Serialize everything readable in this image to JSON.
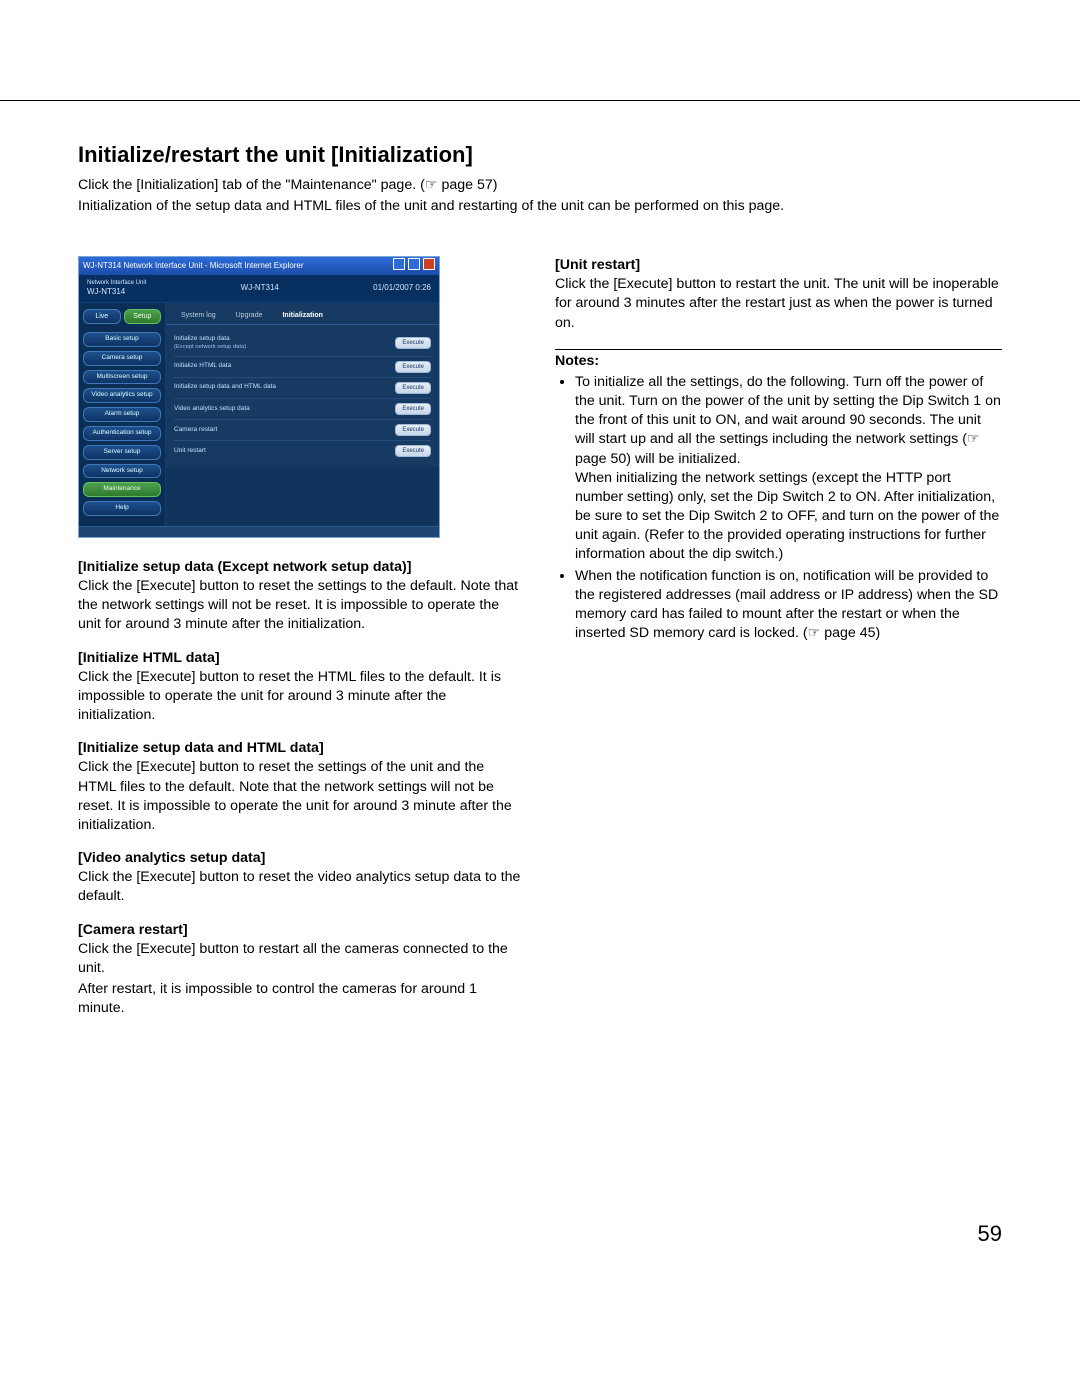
{
  "heading": "Initialize/restart the unit [Initialization]",
  "intro_line1": "Click the [Initialization] tab of the \"Maintenance\" page. (☞ page 57)",
  "intro_line2": "Initialization of the setup data and HTML files of the unit and restarting of the unit can be performed on this page.",
  "page_number": "59",
  "left": {
    "s1_head": "[Initialize setup data (Except network setup data)]",
    "s1_body": "Click the [Execute] button to reset the settings to the default. Note that the network settings will not be reset. It is impossible to operate the unit for around 3 minute after the initialization.",
    "s2_head": "[Initialize HTML data]",
    "s2_body": "Click the [Execute] button to reset the HTML files to the default. It is impossible to operate the unit for around 3 minute after the initialization.",
    "s3_head": "[Initialize setup data and HTML data]",
    "s3_body": "Click the [Execute] button to reset the settings of the unit and the HTML files to the default. Note that the network settings will not be reset. It is impossible to operate the unit for around 3 minute after the initialization.",
    "s4_head": "[Video analytics setup data]",
    "s4_body": "Click the [Execute] button to reset the video analytics setup data to the default.",
    "s5_head": "[Camera restart]",
    "s5_body1": "Click the [Execute] button to restart all the cameras connected to the unit.",
    "s5_body2": "After restart, it is impossible to control the cameras for around 1 minute."
  },
  "right": {
    "s1_head": "[Unit restart]",
    "s1_body": "Click the [Execute] button to restart the unit. The unit will be inoperable for around 3 minutes after the restart just as when the power is turned on.",
    "notes_label": "Notes:",
    "note1": "To initialize all the settings, do the following. Turn off the power of the unit. Turn on the power of the unit by setting the Dip Switch 1 on the front of this unit to ON, and wait around 90 seconds. The unit will start up and all the settings including the network settings (☞ page 50) will be initialized.",
    "note1b": "When initializing the network settings (except the HTTP port number setting) only, set the Dip Switch 2 to ON. After initialization, be sure to set the Dip Switch 2 to OFF, and turn on the power of the unit again. (Refer to the provided operating instructions for further information about the dip switch.)",
    "note2": "When the notification function is on, notification will be provided to the registered addresses (mail address or IP address) when the SD memory card has failed to mount after the restart or when the inserted SD memory card is locked. (☞ page 45)"
  },
  "shot": {
    "window_title": "WJ-NT314 Network Interface Unit - Microsoft Internet Explorer",
    "brand_top": "Network Interface Unit",
    "brand_model": "WJ-NT314",
    "header_model": "WJ-NT314",
    "header_date": "01/01/2007  0:26",
    "top_tabs": {
      "live": "Live",
      "setup": "Setup"
    },
    "sidebar": [
      "Basic setup",
      "Camera setup",
      "Multiscreen setup",
      "Video analytics setup",
      "Alarm setup",
      "Authentication setup",
      "Server setup",
      "Network setup",
      "Maintenance",
      "Help"
    ],
    "sidebar_active_index": 8,
    "main_tabs": [
      "System log",
      "Upgrade",
      "Initialization"
    ],
    "main_tab_selected_index": 2,
    "rows": [
      {
        "label": "Initialize setup data",
        "sub": "(Except network setup data)",
        "btn": "Execute"
      },
      {
        "label": "Initialize HTML data",
        "sub": "",
        "btn": "Execute"
      },
      {
        "label": "Initialize setup data and HTML data",
        "sub": "",
        "btn": "Execute"
      },
      {
        "label": "Video analytics setup data",
        "sub": "",
        "btn": "Execute"
      },
      {
        "label": "Camera restart",
        "sub": "",
        "btn": "Execute"
      },
      {
        "label": "Unit restart",
        "sub": "",
        "btn": "Execute"
      }
    ]
  }
}
